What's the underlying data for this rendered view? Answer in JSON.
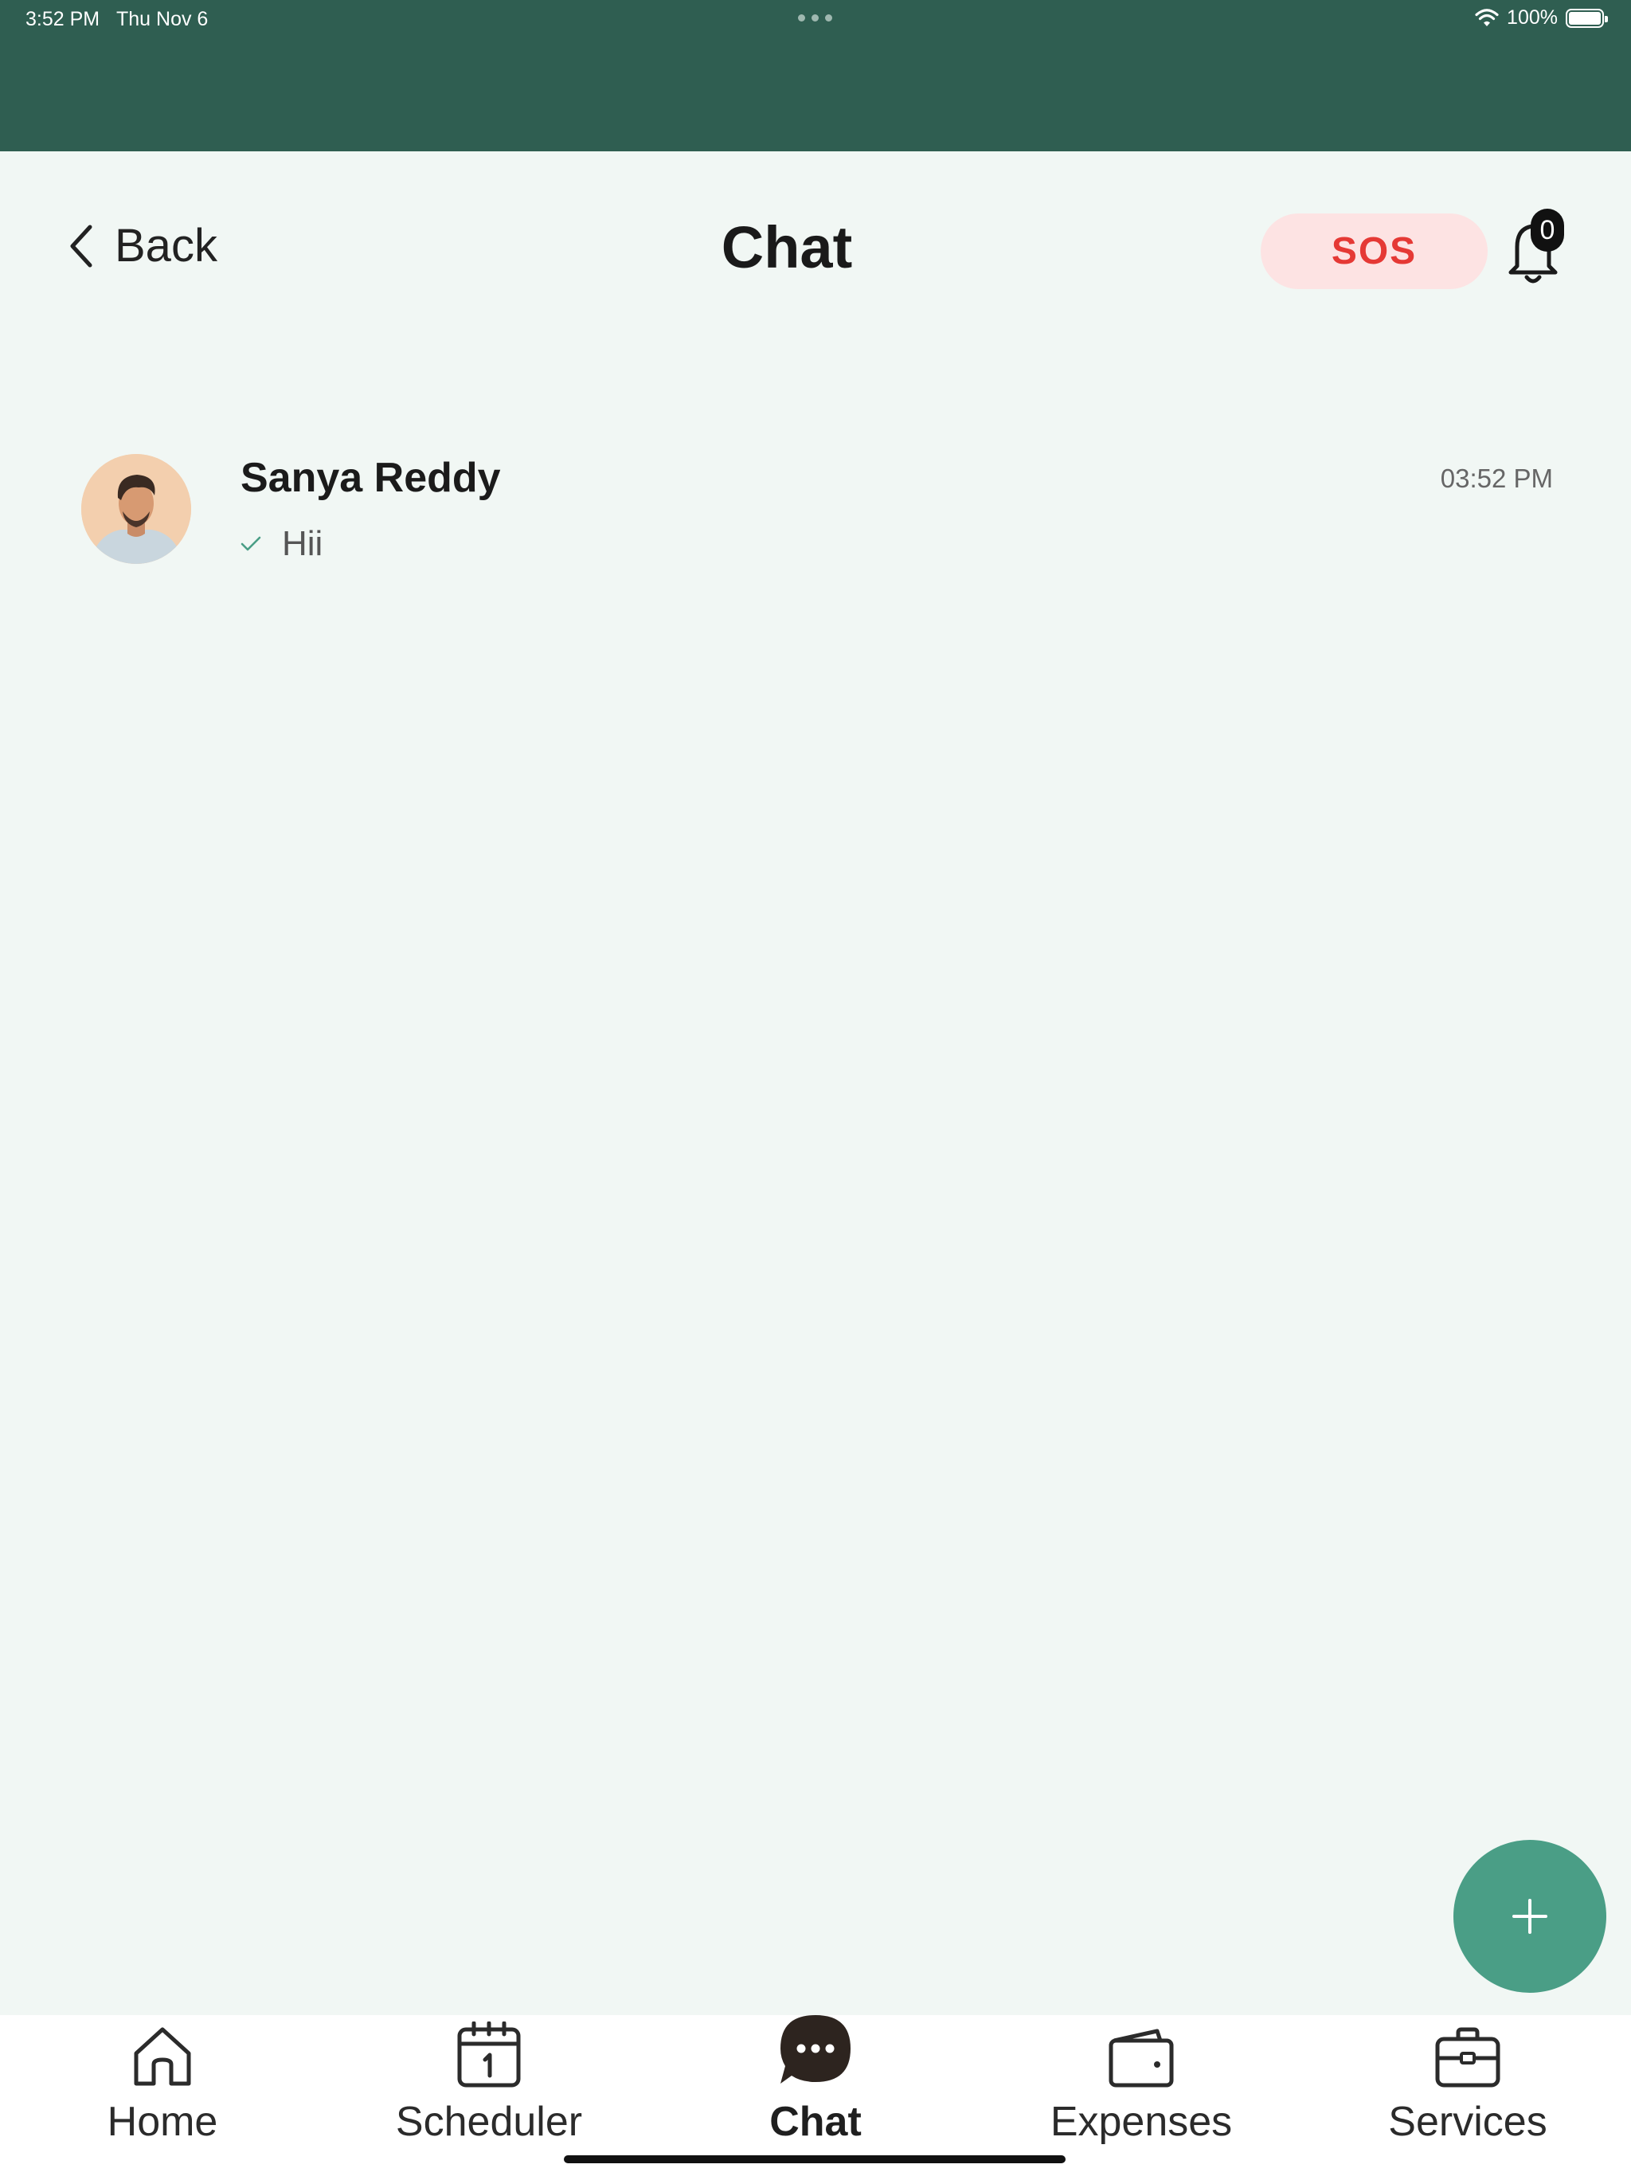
{
  "status_bar": {
    "time": "3:52 PM",
    "date": "Thu Nov 6",
    "battery": "100%"
  },
  "header": {
    "back_label": "Back",
    "title": "Chat",
    "sos_label": "SOS",
    "notification_count": "0"
  },
  "chats": [
    {
      "name": "Sanya Reddy",
      "last_message": "Hii",
      "time": "03:52 PM",
      "status": "sent"
    }
  ],
  "fab": {
    "icon": "plus-icon"
  },
  "tab_bar": {
    "active": "Chat",
    "items": [
      {
        "label": "Home",
        "icon": "home-icon"
      },
      {
        "label": "Scheduler",
        "icon": "calendar-icon"
      },
      {
        "label": "Chat",
        "icon": "chat-bubble-icon"
      },
      {
        "label": "Expenses",
        "icon": "wallet-icon"
      },
      {
        "label": "Services",
        "icon": "briefcase-icon"
      }
    ]
  },
  "colors": {
    "header_band": "#2f5e51",
    "background": "#f1f7f4",
    "sos_bg": "#fde3e3",
    "sos_text": "#e53935",
    "fab": "#4a9e86"
  }
}
